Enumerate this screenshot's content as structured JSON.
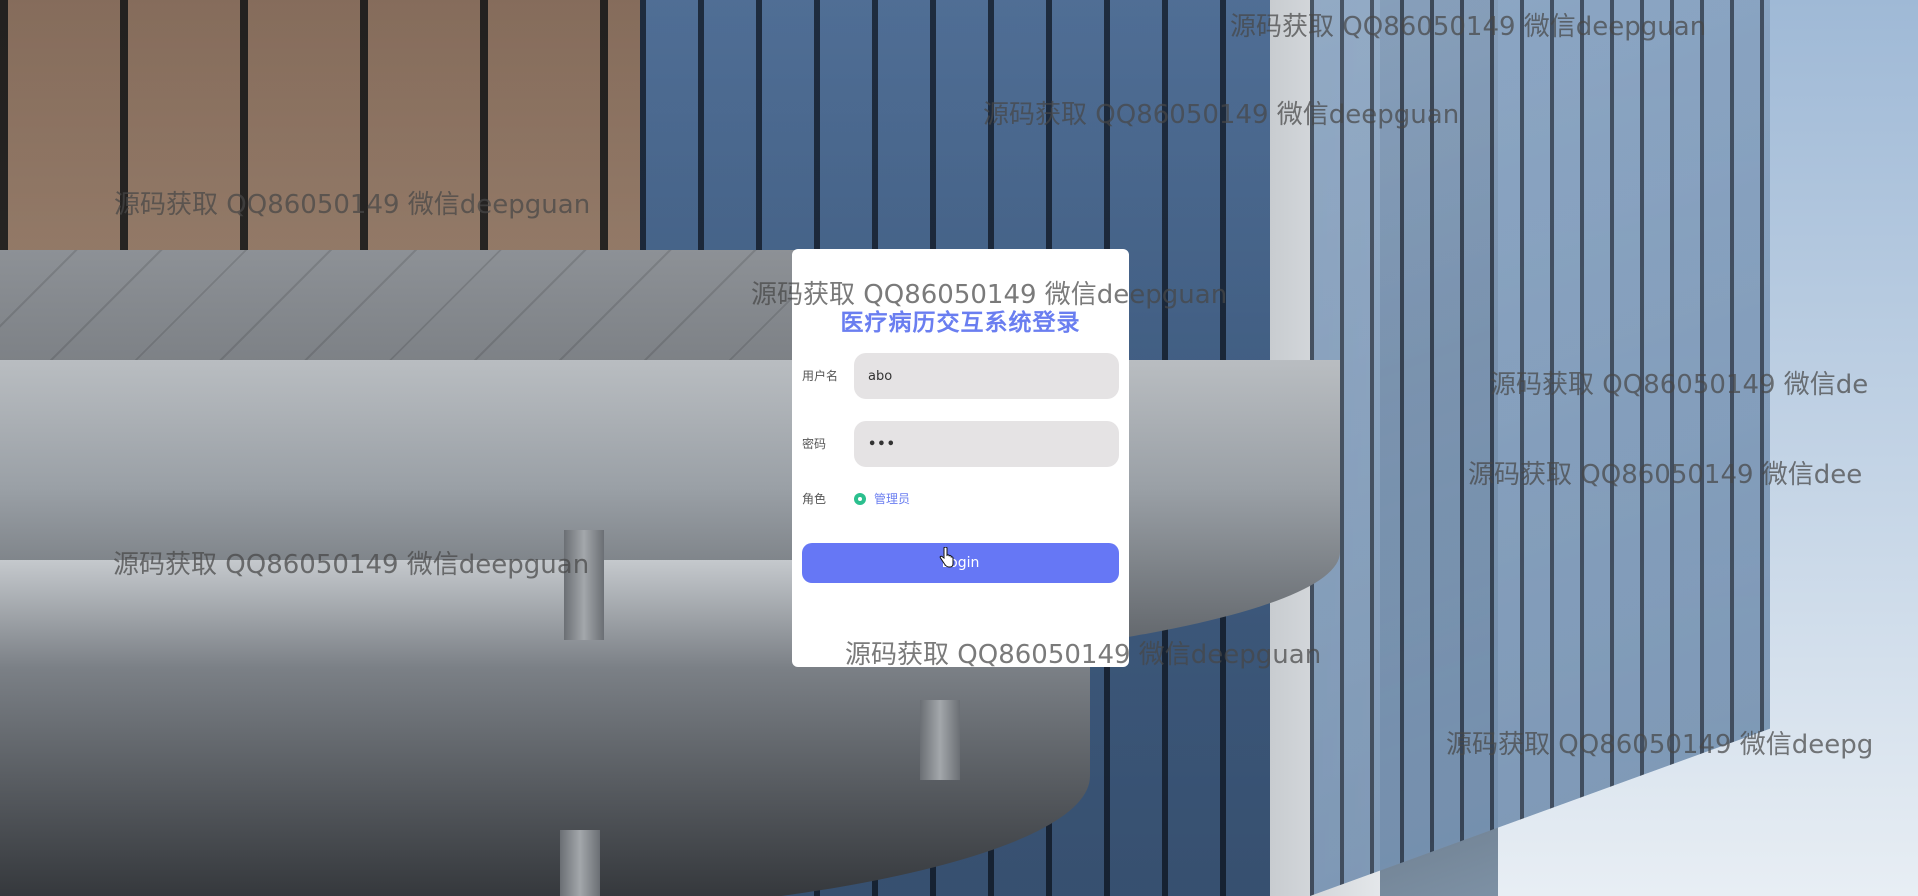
{
  "page": {
    "background_desc": "",
    "accent_color": "#6677f5",
    "title_color": "#6a7ef0",
    "radio_color": "#2bbf8e"
  },
  "watermarks": [
    "源码获取 QQ86050149 微信deepguan",
    "源码获取 QQ86050149 微信deepguan",
    "源码获取 QQ86050149 微信deepguan",
    "源码获取 QQ86050149 微信deepguan",
    "源码获取 QQ86050149 微信de",
    "源码获取 QQ86050149 微信dee",
    "源码获取 QQ86050149 微信deepguan",
    "源码获取 QQ86050149 微信deepguan",
    "源码获取 QQ86050149 微信deepg"
  ],
  "login": {
    "title": "医疗病历交互系统登录",
    "username_label": "用户名",
    "username_value": "abo",
    "password_label": "密码",
    "password_value": "•••",
    "role_label": "角色",
    "role_option": "管理员",
    "role_selected": true,
    "button_label": "Login"
  }
}
